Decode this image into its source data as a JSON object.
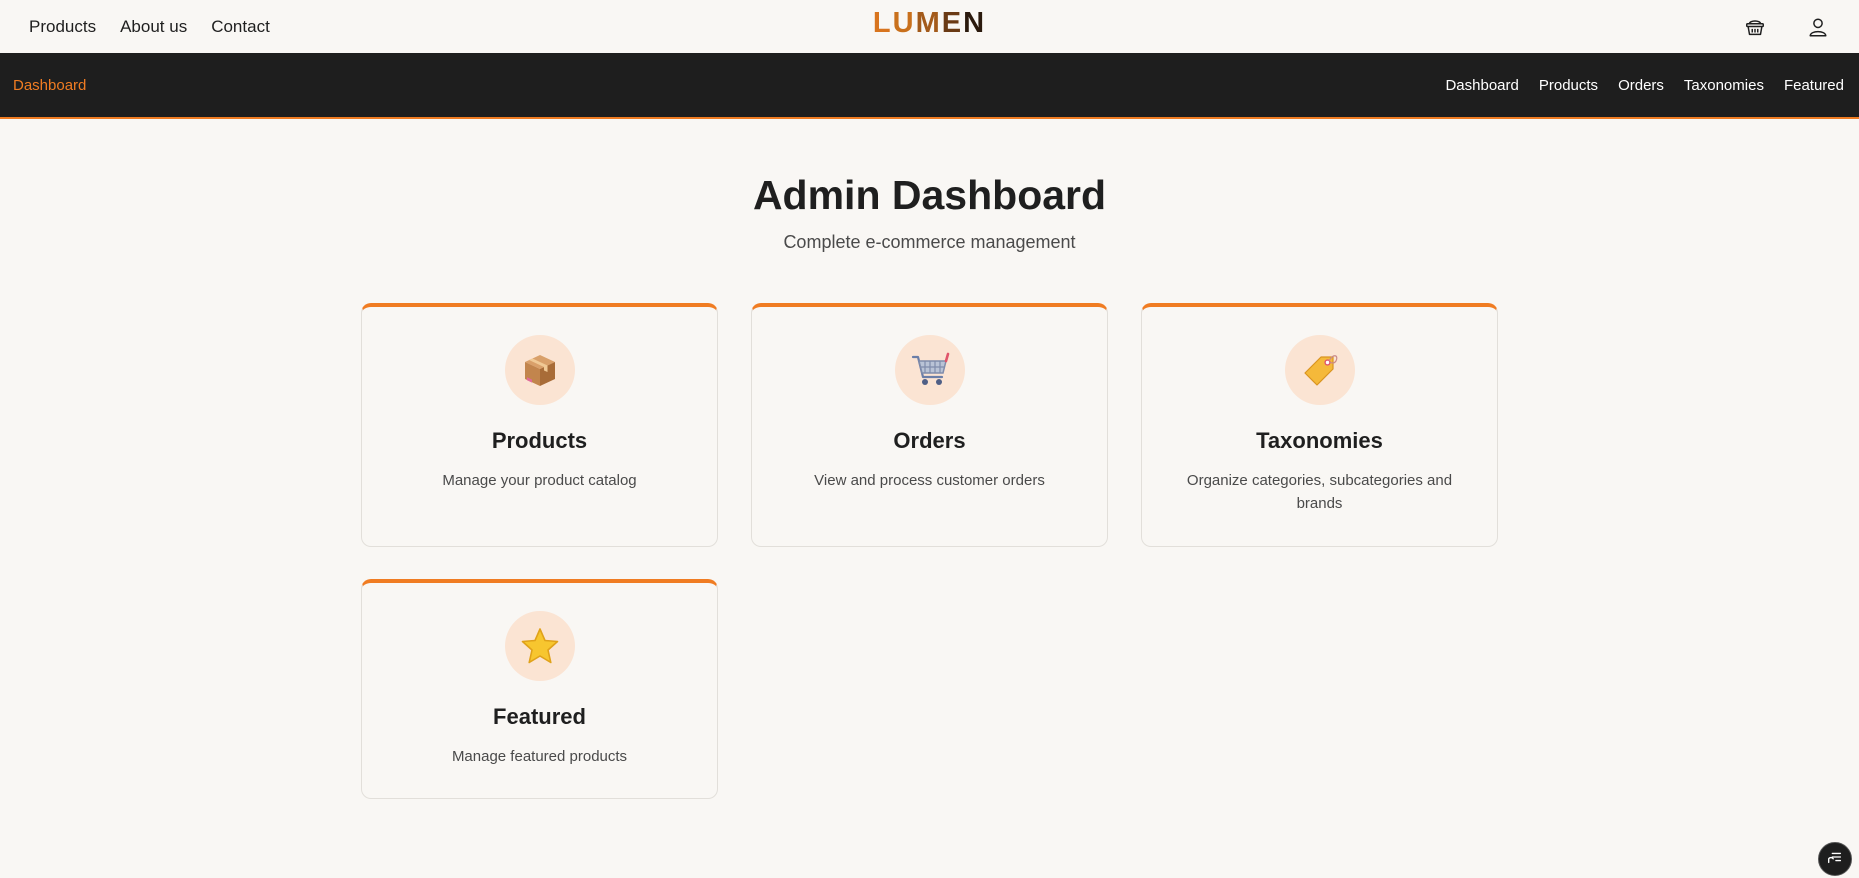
{
  "header": {
    "nav": [
      "Products",
      "About us",
      "Contact"
    ],
    "logo": {
      "letters": [
        "L",
        "U",
        "M",
        "E",
        "N"
      ],
      "colors": [
        "#d8741e",
        "#c9701c",
        "#a35a1a",
        "#6a3a14",
        "#2b1a0d"
      ]
    },
    "icons": [
      "basket-icon",
      "user-icon"
    ]
  },
  "admin_nav": {
    "current": "Dashboard",
    "current_color": "#f07c22",
    "links": [
      "Dashboard",
      "Products",
      "Orders",
      "Taxonomies",
      "Featured"
    ]
  },
  "main": {
    "title": "Admin Dashboard",
    "subtitle": "Complete e-commerce management",
    "cards": [
      {
        "title": "Products",
        "desc": "Manage your product catalog",
        "icon": "package-icon"
      },
      {
        "title": "Orders",
        "desc": "View and process customer orders",
        "icon": "shopping-cart-icon"
      },
      {
        "title": "Taxonomies",
        "desc": "Organize categories, subcategories and brands",
        "icon": "tag-icon"
      },
      {
        "title": "Featured",
        "desc": "Manage featured products",
        "icon": "star-icon"
      }
    ]
  },
  "accent_color": "#f07c22",
  "floating_button": {
    "icon": "chat-menu-icon"
  }
}
